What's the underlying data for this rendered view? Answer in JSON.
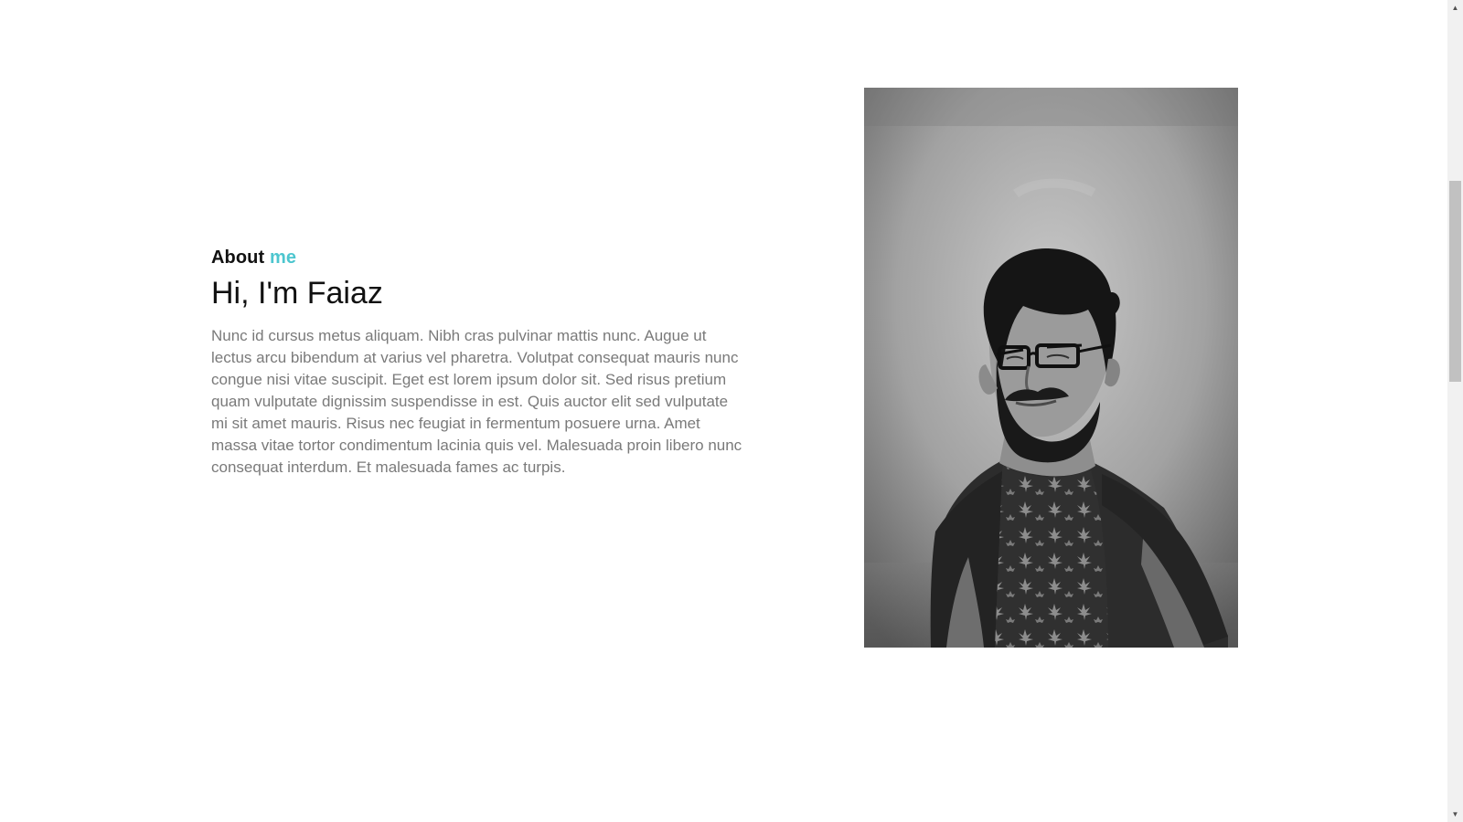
{
  "about": {
    "eyebrow_prefix": "About",
    "eyebrow_accent": "me",
    "headline": "Hi, I'm Faiaz",
    "bio": "Nunc id cursus metus aliquam. Nibh cras pulvinar mattis nunc. Augue ut lectus arcu bibendum at varius vel pharetra. Volutpat consequat mauris nunc congue nisi vitae suscipit. Eget est lorem ipsum dolor sit. Sed risus pretium quam vulputate dignissim suspendisse in est. Quis auctor elit sed vulputate mi sit amet mauris. Risus nec feugiat in fermentum posuere urna. Amet massa vitae tortor condimentum lacinia quis vel. Malesuada proin libero nunc consequat interdum. Et malesuada fames ac turpis."
  },
  "colors": {
    "accent": "#4dc6cf",
    "heading": "#111111",
    "body_text": "#7a7a7a"
  },
  "icons": {
    "scroll_up": "scroll-up-arrow-icon",
    "scroll_down": "scroll-down-arrow-icon"
  }
}
